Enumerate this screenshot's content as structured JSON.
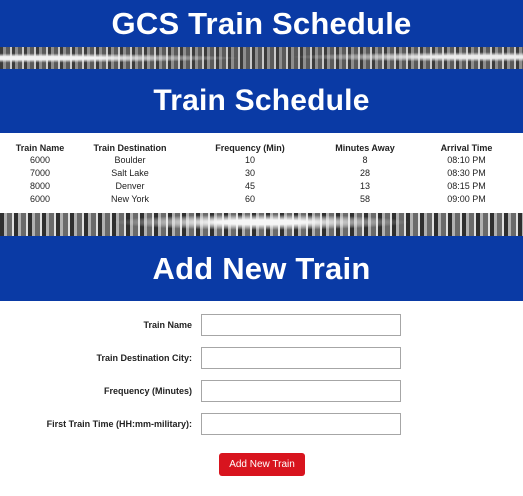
{
  "header": {
    "title": "GCS Train Schedule"
  },
  "schedule": {
    "title": "Train Schedule",
    "columns": [
      "Train Name",
      "Train Destination",
      "Frequency (Min)",
      "Minutes Away",
      "Arrival Time"
    ],
    "rows": [
      [
        "6000",
        "Boulder",
        "10",
        "8",
        "08:10 PM"
      ],
      [
        "7000",
        "Salt Lake",
        "30",
        "28",
        "08:30 PM"
      ],
      [
        "8000",
        "Denver",
        "45",
        "13",
        "08:15 PM"
      ],
      [
        "6000",
        "New York",
        "60",
        "58",
        "09:00 PM"
      ]
    ]
  },
  "add_form": {
    "title": "Add New Train",
    "fields": [
      {
        "label": "Train Name",
        "value": ""
      },
      {
        "label": "Train Destination City:",
        "value": ""
      },
      {
        "label": "Frequency (Minutes)",
        "value": ""
      },
      {
        "label": "First Train Time (HH:mm-military):",
        "value": ""
      }
    ],
    "submit_label": "Add New Train"
  },
  "colors": {
    "banner": "#0a3aa5",
    "button": "#d8141e"
  }
}
